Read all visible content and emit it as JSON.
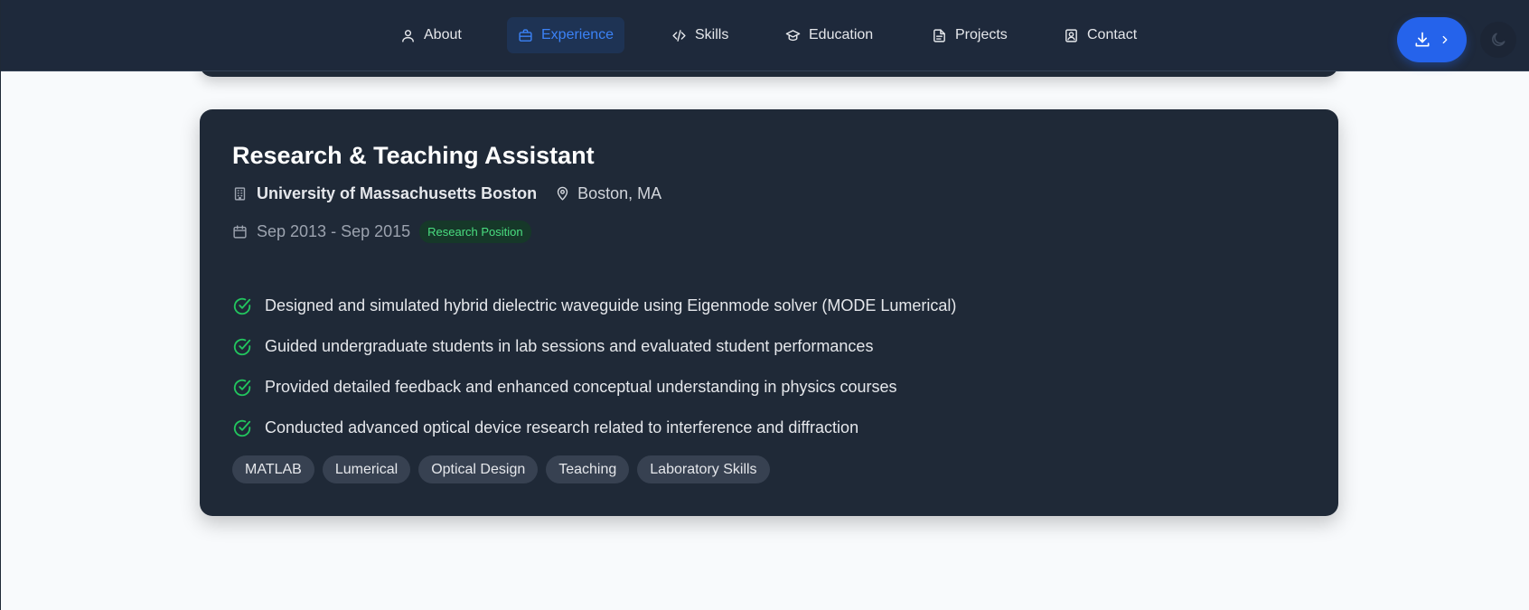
{
  "nav": {
    "items": [
      {
        "label": "About",
        "icon": "user-icon"
      },
      {
        "label": "Experience",
        "icon": "briefcase-icon",
        "active": true
      },
      {
        "label": "Skills",
        "icon": "code-icon"
      },
      {
        "label": "Education",
        "icon": "graduation-cap-icon"
      },
      {
        "label": "Projects",
        "icon": "file-text-icon"
      },
      {
        "label": "Contact",
        "icon": "contact-card-icon"
      }
    ],
    "download_icon": "download-icon",
    "chevron_icon": "chevron-right-icon",
    "theme_icon": "moon-icon"
  },
  "experience": {
    "title": "Research & Teaching Assistant",
    "organization": "University of Massachusetts Boston",
    "location": "Boston, MA",
    "dates": "Sep 2013 - Sep 2015",
    "badge": "Research Position",
    "bullets": [
      "Designed and simulated hybrid dielectric waveguide using Eigenmode solver (MODE Lumerical)",
      "Guided undergraduate students in lab sessions and evaluated student performances",
      "Provided detailed feedback and enhanced conceptual understanding in physics courses",
      "Conducted advanced optical device research related to interference and diffraction"
    ],
    "tags": [
      "MATLAB",
      "Lumerical",
      "Optical Design",
      "Teaching",
      "Laboratory Skills"
    ]
  },
  "colors": {
    "nav_bg": "#1e293b",
    "card_bg": "#1f2937",
    "accent": "#3b82f6",
    "primary_button": "#2563eb",
    "check": "#22c55e",
    "badge_text": "#4ade80",
    "page_bg": "#f8fafc"
  }
}
